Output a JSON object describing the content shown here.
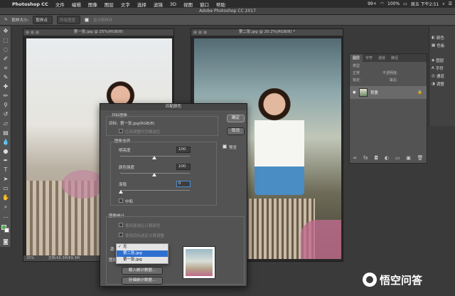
{
  "menubar": {
    "app_name": "Photoshop CC",
    "items": [
      "文件",
      "编辑",
      "图像",
      "图层",
      "文字",
      "选择",
      "滤镜",
      "3D",
      "视图",
      "窗口",
      "帮助"
    ],
    "status": {
      "badge": "99+",
      "battery": "100%",
      "clock": "周五 下午2:51"
    }
  },
  "window": {
    "title": "Adobe Photoshop CC 2017"
  },
  "options": {
    "sample_size_label": "取样大小:",
    "sample_size_value": "取样点",
    "sample_all_layers": "所有图层",
    "show_sampling_ring": "显示取样环"
  },
  "documents": [
    {
      "title": "第一张.jpg @ 25%(RGB/8)",
      "zoom": "25%",
      "doc_info": "文档:69.3M/69.3M"
    },
    {
      "title": "第二张.jpg @ 20.2%(RGB/8) *"
    }
  ],
  "right_dock": {
    "items": [
      "颜色",
      "色板",
      "图层",
      "字符",
      "通道",
      "调整"
    ]
  },
  "layers_panel": {
    "tabs": [
      "图层",
      "字符",
      "通道",
      "路径"
    ],
    "kind_label": "类型",
    "blend_mode": "正常",
    "opacity_label": "不透明度:",
    "lock_label": "锁定:",
    "fill_label": "填充:",
    "layer_name": "背景"
  },
  "dialog": {
    "title": "匹配颜色",
    "target_section": "目标图像",
    "target_label": "目标:",
    "target_value": "第一张.jpg(RGB/8)",
    "ignore_selection": "应用调整时忽略选区",
    "image_options_section": "图像选项",
    "luminance_label": "明亮度",
    "luminance_value": "100",
    "color_intensity_label": "颜色强度",
    "color_intensity_value": "100",
    "fade_label": "渐隐",
    "fade_value": "0",
    "neutralize_label": "中和",
    "ok_button": "确定",
    "cancel_button": "取消",
    "preview_label": "预览",
    "image_stats_section": "图像统计",
    "use_source_selection": "使用源选区计算颜色",
    "use_target_selection": "使用目标选区计算调整",
    "source_label": "源:",
    "layer_label": "图层:",
    "load_stats_button": "载入统计数据...",
    "save_stats_button": "存储统计数据...",
    "dropdown_options": [
      "无",
      "第二张.jpg",
      "第一张.jpg"
    ],
    "dropdown_selected": "第二张.jpg"
  },
  "watermark": {
    "text": "悟空问答"
  },
  "colors": {
    "ps_panel": "#535353",
    "selection_blue": "#2f6fd0",
    "foreground_color": "#4caf50"
  }
}
